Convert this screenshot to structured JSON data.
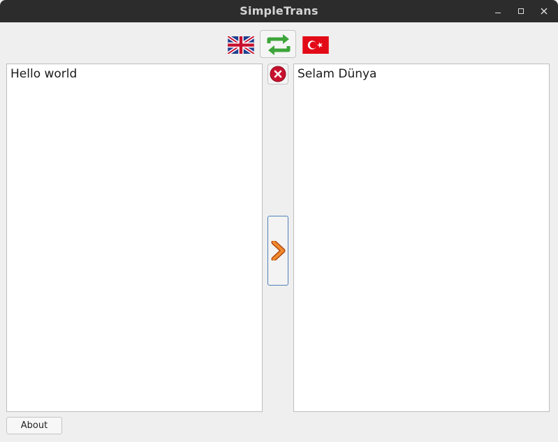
{
  "window": {
    "title": "SimpleTrans"
  },
  "toolbar": {
    "source_language_flag": "uk-flag-icon",
    "target_language_flag": "turkey-flag-icon",
    "swap_icon": "swap-arrows-icon"
  },
  "source_pane": {
    "text": "Hello world"
  },
  "target_pane": {
    "text": "Selam Dünya"
  },
  "controls": {
    "clear_icon": "clear-icon",
    "translate_icon": "chevron-right-icon"
  },
  "footer": {
    "about_label": "About"
  },
  "colors": {
    "titlebar": "#2c2c2c",
    "background": "#efefef",
    "swap_green": "#3da53a",
    "clear_red": "#c8102e",
    "chevron_orange": "#e06a1b"
  }
}
